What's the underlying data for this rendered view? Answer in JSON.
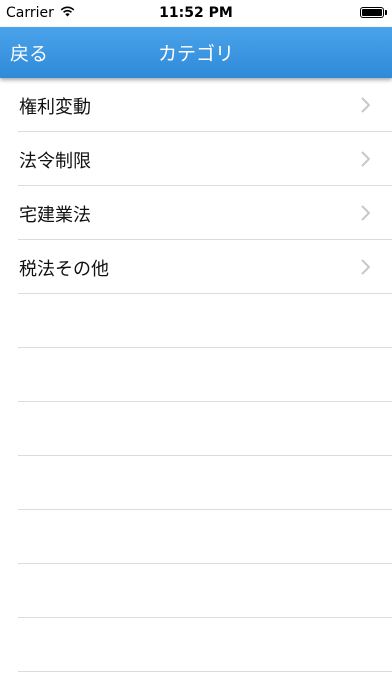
{
  "status_bar": {
    "carrier": "Carrier",
    "wifi_icon": "wifi-icon",
    "time": "11:52 PM",
    "battery_icon": "battery-icon"
  },
  "nav": {
    "back_label": "戻る",
    "title": "カテゴリ",
    "color": "#3a96e2"
  },
  "categories": [
    {
      "label": "権利変動"
    },
    {
      "label": "法令制限"
    },
    {
      "label": "宅建業法"
    },
    {
      "label": "税法その他"
    }
  ],
  "empty_row_count": 7
}
